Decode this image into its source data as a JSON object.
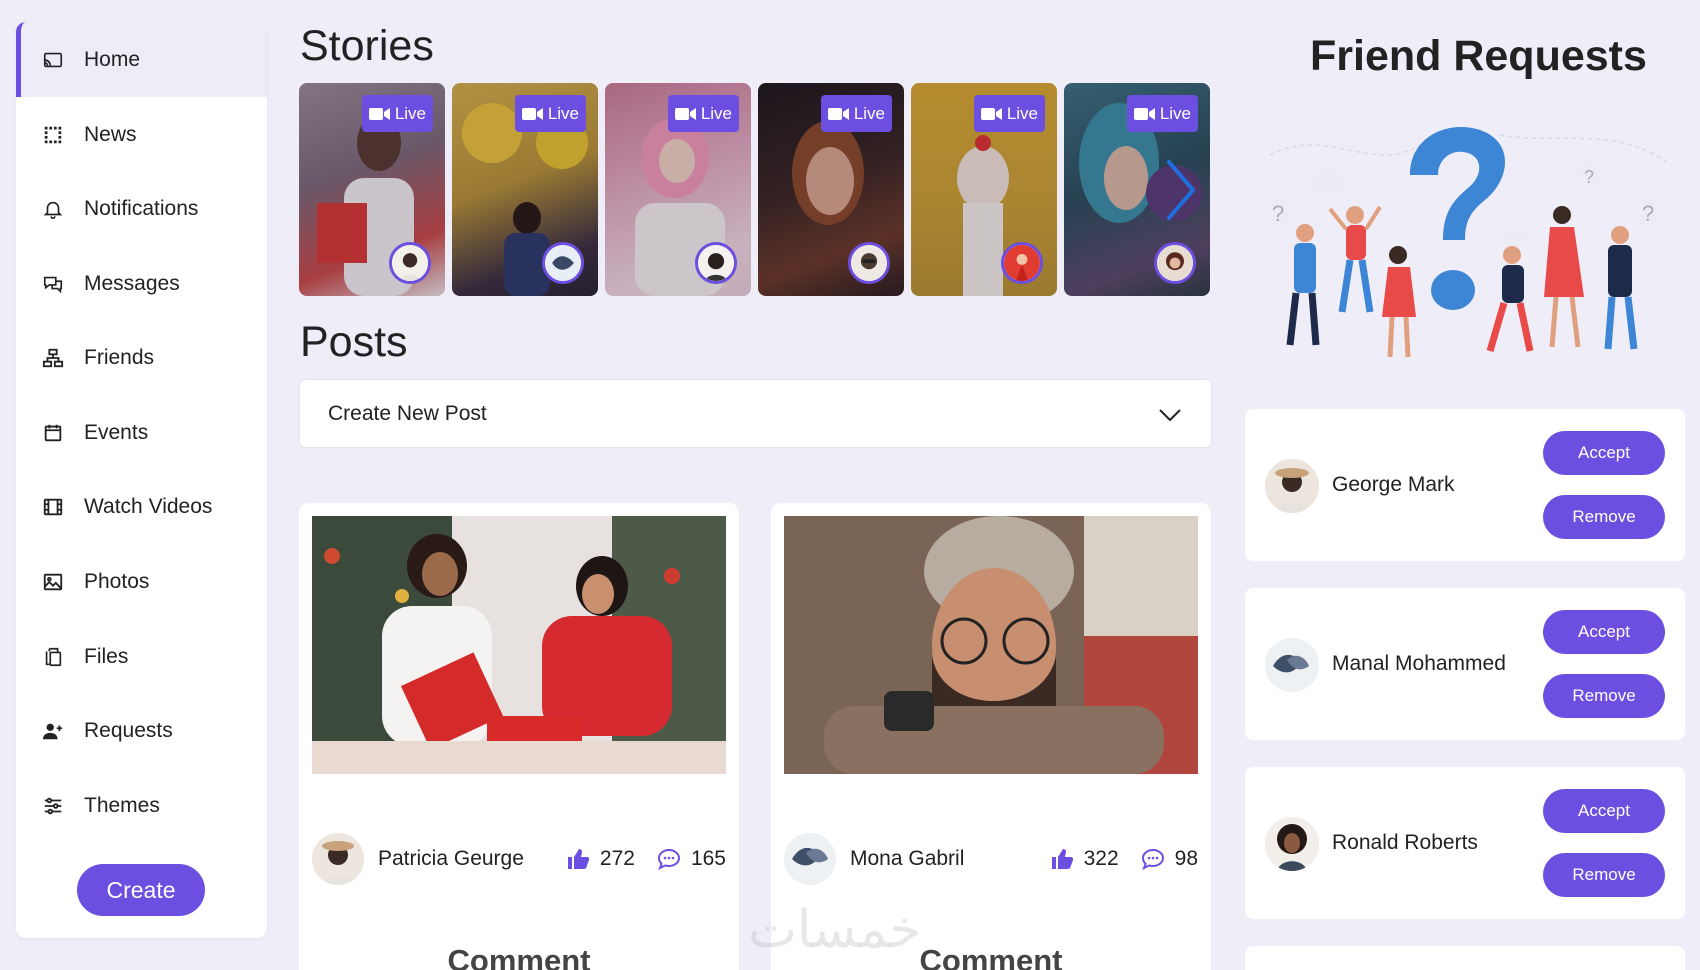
{
  "sidebar": {
    "items": [
      {
        "label": "Home",
        "icon": "cast-icon"
      },
      {
        "label": "News",
        "icon": "grid-icon"
      },
      {
        "label": "Notifications",
        "icon": "bell-icon"
      },
      {
        "label": "Messages",
        "icon": "chat-icon"
      },
      {
        "label": "Friends",
        "icon": "network-icon"
      },
      {
        "label": "Events",
        "icon": "calendar-icon"
      },
      {
        "label": "Watch Videos",
        "icon": "film-icon"
      },
      {
        "label": "Photos",
        "icon": "image-icon"
      },
      {
        "label": "Files",
        "icon": "files-icon"
      },
      {
        "label": "Requests",
        "icon": "user-plus-icon"
      },
      {
        "label": "Themes",
        "icon": "sliders-icon"
      }
    ],
    "create_label": "Create"
  },
  "stories": {
    "title": "Stories",
    "live_label": "Live",
    "items": [
      {
        "bg": "#8a7a8a"
      },
      {
        "bg": "#c5a24a"
      },
      {
        "bg": "#d79aae"
      },
      {
        "bg": "#3b2b2b"
      },
      {
        "bg": "#d6a533"
      },
      {
        "bg": "#3e6b7a"
      }
    ]
  },
  "posts": {
    "title": "Posts",
    "create_post_label": "Create New Post",
    "items": [
      {
        "author": "Patricia Geurge",
        "likes": "272",
        "comments": "165",
        "comment_heading": "Comment"
      },
      {
        "author": "Mona Gabril",
        "likes": "322",
        "comments": "98",
        "comment_heading": "Comment"
      }
    ]
  },
  "friend_requests": {
    "title": "Friend Requests",
    "accept_label": "Accept",
    "remove_label": "Remove",
    "items": [
      {
        "name": "George Mark"
      },
      {
        "name": "Manal Mohammed"
      },
      {
        "name": "Ronald Roberts"
      }
    ]
  },
  "watermark": "خمسات",
  "colors": {
    "accent": "#6c4ee0",
    "background": "#efeef8"
  }
}
